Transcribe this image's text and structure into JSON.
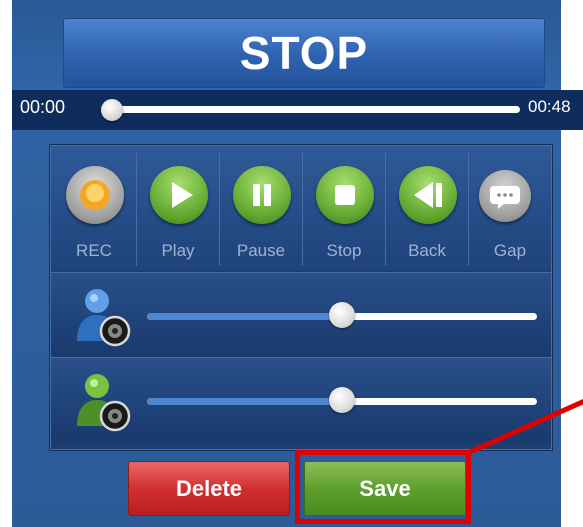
{
  "header": {
    "title": "STOP"
  },
  "timeline": {
    "current_time": "00:00",
    "total_time": "00:48",
    "position_fraction": 0.0
  },
  "controls": [
    {
      "id": "rec",
      "label": "REC",
      "icon": "record-icon",
      "color": "#9a9a9a"
    },
    {
      "id": "play",
      "label": "Play",
      "icon": "play-icon",
      "color": "#62a830"
    },
    {
      "id": "pause",
      "label": "Pause",
      "icon": "pause-icon",
      "color": "#62a830"
    },
    {
      "id": "stop",
      "label": "Stop",
      "icon": "stop-icon",
      "color": "#62a830"
    },
    {
      "id": "back",
      "label": "Back",
      "icon": "back-icon",
      "color": "#62a830"
    },
    {
      "id": "gap",
      "label": "Gap",
      "icon": "speech-bubble-icon",
      "color": "#9a9a9a"
    }
  ],
  "volume_sliders": [
    {
      "id": "speaker-1",
      "icon": "person-speaker-blue-icon",
      "level_fraction": 0.5,
      "color": "#3a78c8"
    },
    {
      "id": "speaker-2",
      "icon": "person-speaker-green-icon",
      "level_fraction": 0.5,
      "color": "#4f8f2a"
    }
  ],
  "actions": {
    "delete_label": "Delete",
    "save_label": "Save"
  },
  "colors": {
    "accent_red": "#e00000",
    "save_green": "#5f9f2e",
    "delete_red": "#d22f2f"
  }
}
